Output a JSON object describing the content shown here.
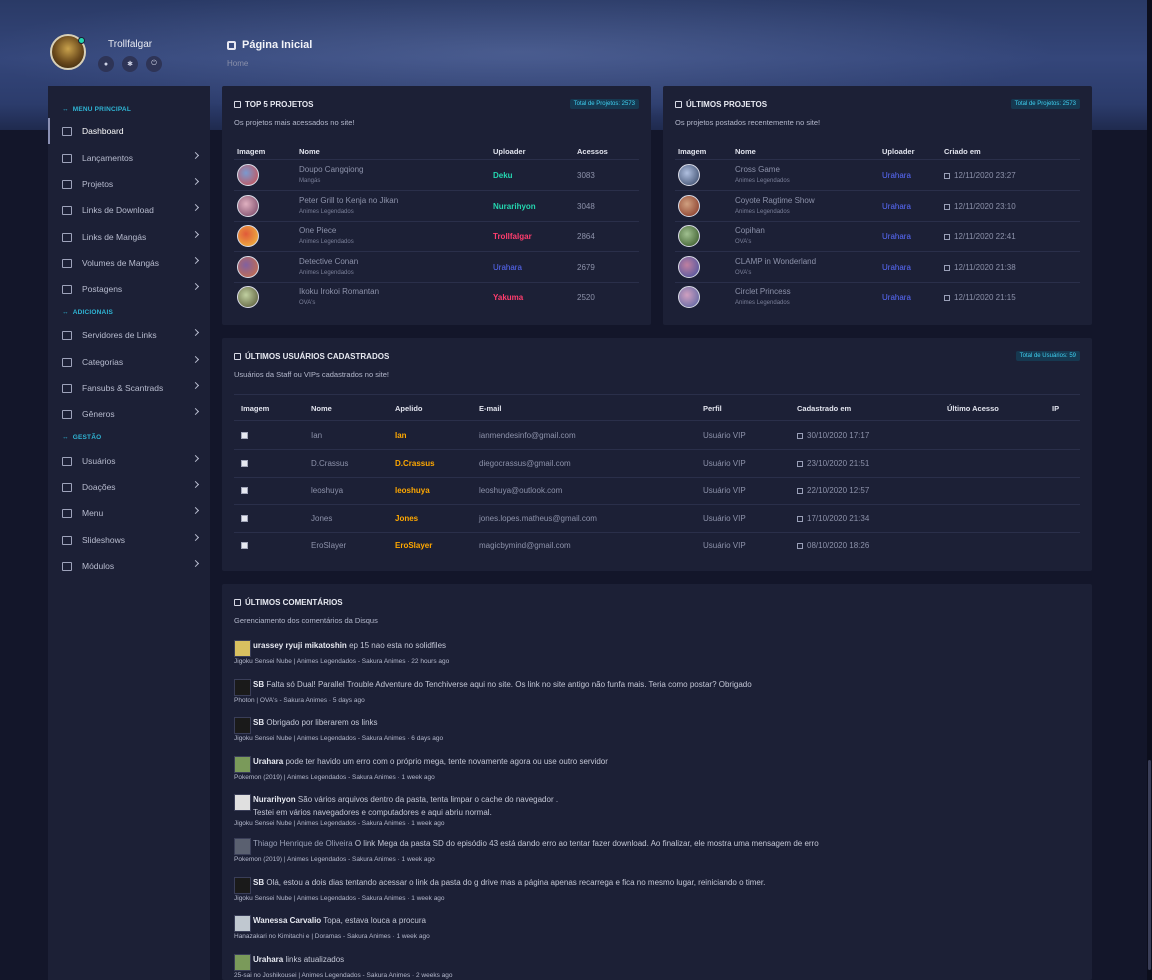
{
  "colors": {
    "accent": "#2fb4d4",
    "bg": "#13162a",
    "panel": "#1c2036",
    "teal": "#24d6b0",
    "red": "#ff3d6e",
    "blue": "#5a6cff",
    "orange": "#ffa800"
  },
  "profile": {
    "username": "Trollfalgar",
    "icons": [
      "user-icon",
      "gear-icon",
      "power-icon"
    ]
  },
  "header": {
    "title": "Página Inicial",
    "breadcrumb": "Home"
  },
  "sidebar": {
    "sections": [
      "MENU PRINCIPAL",
      "ADICIONAIS",
      "GESTÃO"
    ],
    "items": [
      {
        "label": "Dashboard",
        "icon": "monitor-icon"
      },
      {
        "label": "Lançamentos",
        "icon": "new-badge-icon"
      },
      {
        "label": "Projetos",
        "icon": "play-icon"
      },
      {
        "label": "Links de Download",
        "icon": "download-icon"
      },
      {
        "label": "Links de Mangás",
        "icon": "file-icon"
      },
      {
        "label": "Volumes de Mangás",
        "icon": "books-icon"
      },
      {
        "label": "Postagens",
        "icon": "newspaper-icon"
      },
      {
        "label": "Servidores de Links",
        "icon": "server-icon"
      },
      {
        "label": "Categorias",
        "icon": "list-icon"
      },
      {
        "label": "Fansubs & Scantrads",
        "icon": "bracket-icon"
      },
      {
        "label": "Gêneros",
        "icon": "tag-icon"
      },
      {
        "label": "Usuários",
        "icon": "users-icon"
      },
      {
        "label": "Doações",
        "icon": "donation-icon"
      },
      {
        "label": "Menu",
        "icon": "menu-icon"
      },
      {
        "label": "Slideshows",
        "icon": "image-icon"
      },
      {
        "label": "Módulos",
        "icon": "modules-icon"
      }
    ]
  },
  "top5": {
    "title": "TOP 5 PROJETOS",
    "badge": "Total de Projetos: 2573",
    "subtitle": "Os projetos mais acessados no site!",
    "headers": [
      "Imagem",
      "Nome",
      "Uploader",
      "Acessos"
    ],
    "rows": [
      {
        "name": "Doupo Cangqiong",
        "category": "Mangás",
        "uploader": "Deku",
        "accesses": "3083"
      },
      {
        "name": "Peter Grill to Kenja no Jikan",
        "category": "Animes Legendados",
        "uploader": "Nurarihyon",
        "accesses": "3048"
      },
      {
        "name": "One Piece",
        "category": "Animes Legendados",
        "uploader": "Trollfalgar",
        "accesses": "2864"
      },
      {
        "name": "Detective Conan",
        "category": "Animes Legendados",
        "uploader": "Urahara",
        "accesses": "2679"
      },
      {
        "name": "Ikoku Irokoi Romantan",
        "category": "OVA's",
        "uploader": "Yakuma",
        "accesses": "2520"
      }
    ]
  },
  "latest_projects": {
    "title": "ÚLTIMOS PROJETOS",
    "badge": "Total de Projetos: 2573",
    "subtitle": "Os projetos postados recentemente no site!",
    "headers": [
      "Imagem",
      "Nome",
      "Uploader",
      "Criado em"
    ],
    "rows": [
      {
        "name": "Cross Game",
        "category": "Animes Legendados",
        "uploader": "Urahara",
        "created": "12/11/2020 23:27"
      },
      {
        "name": "Coyote Ragtime Show",
        "category": "Animes Legendados",
        "uploader": "Urahara",
        "created": "12/11/2020 23:10"
      },
      {
        "name": "Copihan",
        "category": "OVA's",
        "uploader": "Urahara",
        "created": "12/11/2020 22:41"
      },
      {
        "name": "CLAMP in Wonderland",
        "category": "OVA's",
        "uploader": "Urahara",
        "created": "12/11/2020 21:38"
      },
      {
        "name": "Circlet Princess",
        "category": "Animes Legendados",
        "uploader": "Urahara",
        "created": "12/11/2020 21:15"
      }
    ]
  },
  "users": {
    "title": "ÚLTIMOS USUÁRIOS CADASTRADOS",
    "badge": "Total de Usuários: 59",
    "subtitle": "Usuários da Staff ou VIPs cadastrados no site!",
    "headers": [
      "Imagem",
      "Nome",
      "Apelido",
      "E-mail",
      "Perfil",
      "Cadastrado em",
      "Último Acesso",
      "IP"
    ],
    "rows": [
      {
        "name": "Ian",
        "nick": "Ian",
        "email": "ianmendesinfo@gmail.com",
        "profile": "Usuário VIP",
        "registered": "30/10/2020 17:17"
      },
      {
        "name": "D.Crassus",
        "nick": "D.Crassus",
        "email": "diegocrassus@gmail.com",
        "profile": "Usuário VIP",
        "registered": "23/10/2020 21:51"
      },
      {
        "name": "leoshuya",
        "nick": "leoshuya",
        "email": "leoshuya@outlook.com",
        "profile": "Usuário VIP",
        "registered": "22/10/2020 12:57"
      },
      {
        "name": "Jones",
        "nick": "Jones",
        "email": "jones.lopes.matheus@gmail.com",
        "profile": "Usuário VIP",
        "registered": "17/10/2020 21:34"
      },
      {
        "name": "EroSlayer",
        "nick": "EroSlayer",
        "email": "magicbymind@gmail.com",
        "profile": "Usuário VIP",
        "registered": "08/10/2020 18:26"
      }
    ]
  },
  "comments": {
    "title": "ÚLTIMOS COMENTÁRIOS",
    "subtitle": "Gerenciamento dos comentários da Disqus",
    "items": [
      {
        "author": "urassey ryuji mikatoshin",
        "text": "ep 15 nao esta no solidfiles",
        "text2": "",
        "meta": "Jigoku Sensei Nube | Animes Legendados - Sakura Animes · 22 hours ago"
      },
      {
        "author": "SB",
        "text": "Falta só Dual! Parallel Trouble Adventure do Tenchiverse aqui no site. Os link no site antigo não funfa mais. Teria como postar? Obrigado",
        "text2": "",
        "meta": "Photon | OVA's - Sakura Animes · 5 days ago"
      },
      {
        "author": "SB",
        "text": "Obrigado por liberarem os links",
        "text2": "",
        "meta": "Jigoku Sensei Nube | Animes Legendados - Sakura Animes · 6 days ago"
      },
      {
        "author": "Urahara",
        "text": "pode ter havido um erro com o próprio mega, tente novamente agora ou use outro servidor",
        "text2": "",
        "meta": "Pokemon (2019) | Animes Legendados - Sakura Animes · 1 week ago"
      },
      {
        "author": "Nurarihyon",
        "text": "São vários arquivos dentro da pasta, tenta limpar o cache do navegador .",
        "text2": "Testei em vários navegadores e computadores e aqui abriu normal.",
        "meta": "Jigoku Sensei Nube | Animes Legendados - Sakura Animes · 1 week ago"
      },
      {
        "author": "Thiago Henrique de Oliveira",
        "text": "O link Mega da pasta SD do episódio 43 está dando erro ao tentar fazer download. Ao finalizar, ele mostra uma mensagem de erro",
        "text2": "",
        "meta": "Pokemon (2019) | Animes Legendados - Sakura Animes · 1 week ago"
      },
      {
        "author": "SB",
        "text": "Olá, estou a dois dias tentando acessar o link da pasta do g drive mas a página apenas recarrega e fica no mesmo lugar, reiniciando o timer.",
        "text2": "",
        "meta": "Jigoku Sensei Nube | Animes Legendados - Sakura Animes · 1 week ago"
      },
      {
        "author": "Wanessa Carvalio",
        "text": "Topa, estava louca a procura",
        "text2": "",
        "meta": "Hanazakari no Kimitachi e | Doramas - Sakura Animes · 1 week ago"
      },
      {
        "author": "Urahara",
        "text": "links atualizados",
        "text2": "",
        "meta": "25-sai no Joshikousei | Animes Legendados - Sakura Animes · 2 weeks ago"
      }
    ]
  }
}
